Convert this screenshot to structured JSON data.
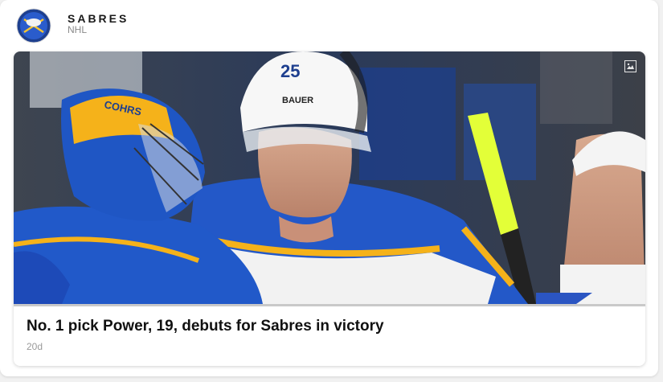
{
  "team": {
    "name": "SABRES",
    "league": "NHL"
  },
  "story": {
    "headline": "No. 1 pick Power, 19, debuts for Sabres in victory",
    "age": "20d"
  },
  "photo": {
    "jersey_number": "25",
    "helmet_brand": "BAUER",
    "mask_text": "COHRS",
    "icon": "image-icon"
  },
  "colors": {
    "sabres_blue": "#1f4fbd",
    "sabres_gold": "#f5b21a",
    "card_bg": "#ffffff",
    "page_bg": "#f1f1f1"
  }
}
